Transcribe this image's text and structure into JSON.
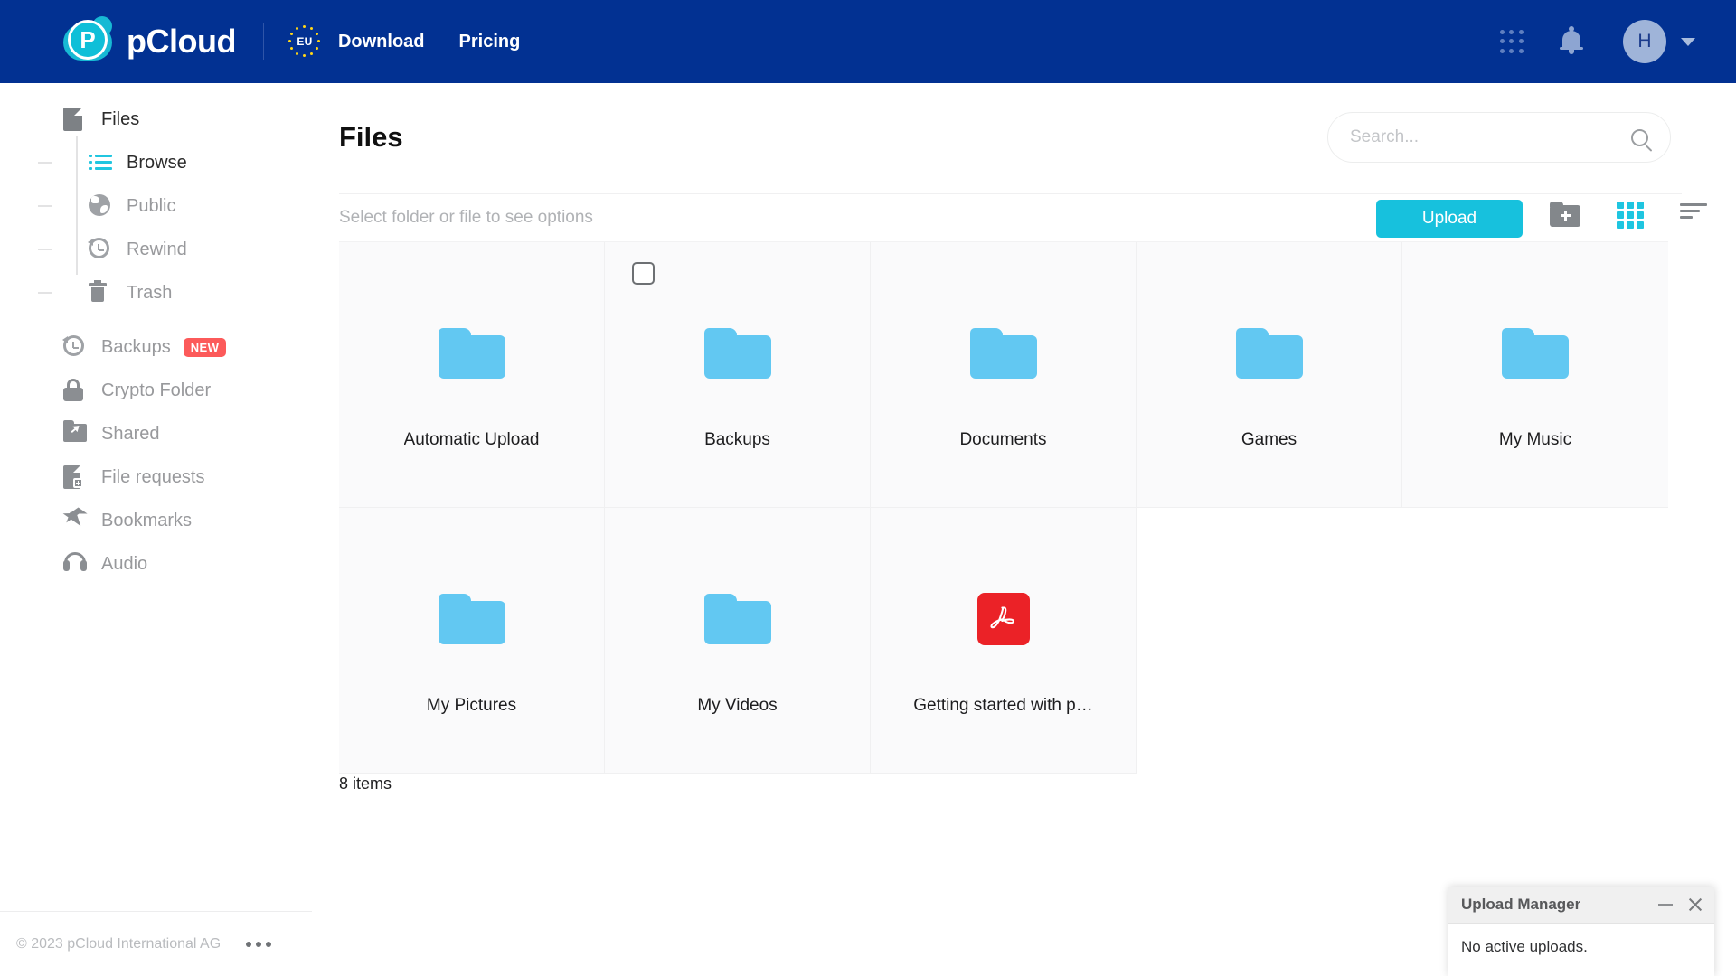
{
  "topbar": {
    "logo_text": "pCloud",
    "logo_mark_letter": "P",
    "eu_badge_label": "EU",
    "nav": [
      {
        "label": "Download"
      },
      {
        "label": "Pricing"
      }
    ],
    "apps_icon": "grid-apps-icon",
    "notifications_icon": "bell-icon",
    "avatar_initial": "H",
    "brand_blue": "#023192",
    "accent_cyan": "#17c1dd"
  },
  "sidebar": {
    "root": {
      "label": "Files",
      "icon": "file-icon",
      "active": true
    },
    "children": [
      {
        "label": "Browse",
        "icon": "list-icon",
        "active": true
      },
      {
        "label": "Public",
        "icon": "globe-icon",
        "active": false
      },
      {
        "label": "Rewind",
        "icon": "rewind-icon",
        "active": false
      },
      {
        "label": "Trash",
        "icon": "trash-icon",
        "active": false
      }
    ],
    "items": [
      {
        "label": "Backups",
        "icon": "rewind-icon",
        "badge": "NEW"
      },
      {
        "label": "Crypto Folder",
        "icon": "lock-icon",
        "badge": ""
      },
      {
        "label": "Shared",
        "icon": "shared-folder-icon",
        "badge": ""
      },
      {
        "label": "File requests",
        "icon": "file-request-icon",
        "badge": ""
      },
      {
        "label": "Bookmarks",
        "icon": "star-icon",
        "badge": ""
      },
      {
        "label": "Audio",
        "icon": "headphones-icon",
        "badge": ""
      }
    ],
    "badge_color": "#fc5a5a",
    "footer": {
      "copyright": "© 2023 pCloud International AG",
      "more_icon": "ellipsis-icon"
    }
  },
  "main": {
    "page_title": "Files",
    "search": {
      "placeholder": "Search...",
      "value": "",
      "icon": "search-icon"
    },
    "toolbar": {
      "hint": "Select folder or file to see options",
      "upload_label": "Upload",
      "new_folder_icon": "new-folder-icon",
      "grid_view_icon": "grid-view-icon",
      "sort_icon": "sort-icon"
    },
    "items_count": "8 items",
    "files": [
      {
        "name": "Automatic Upload",
        "type": "folder",
        "checkbox_visible": false
      },
      {
        "name": "Backups",
        "type": "folder",
        "checkbox_visible": true
      },
      {
        "name": "Documents",
        "type": "folder",
        "checkbox_visible": false
      },
      {
        "name": "Games",
        "type": "folder",
        "checkbox_visible": false
      },
      {
        "name": "My Music",
        "type": "folder",
        "checkbox_visible": false
      },
      {
        "name": "My Pictures",
        "type": "folder",
        "checkbox_visible": false
      },
      {
        "name": "My Videos",
        "type": "folder",
        "checkbox_visible": false
      },
      {
        "name": "Getting started with p…",
        "type": "pdf",
        "checkbox_visible": false
      }
    ],
    "folder_color": "#62c8f2",
    "pdf_color": "#eb2227"
  },
  "upload_manager": {
    "title": "Upload Manager",
    "body_text": "No active uploads.",
    "minimize_icon": "minimize-icon",
    "close_icon": "close-icon"
  }
}
